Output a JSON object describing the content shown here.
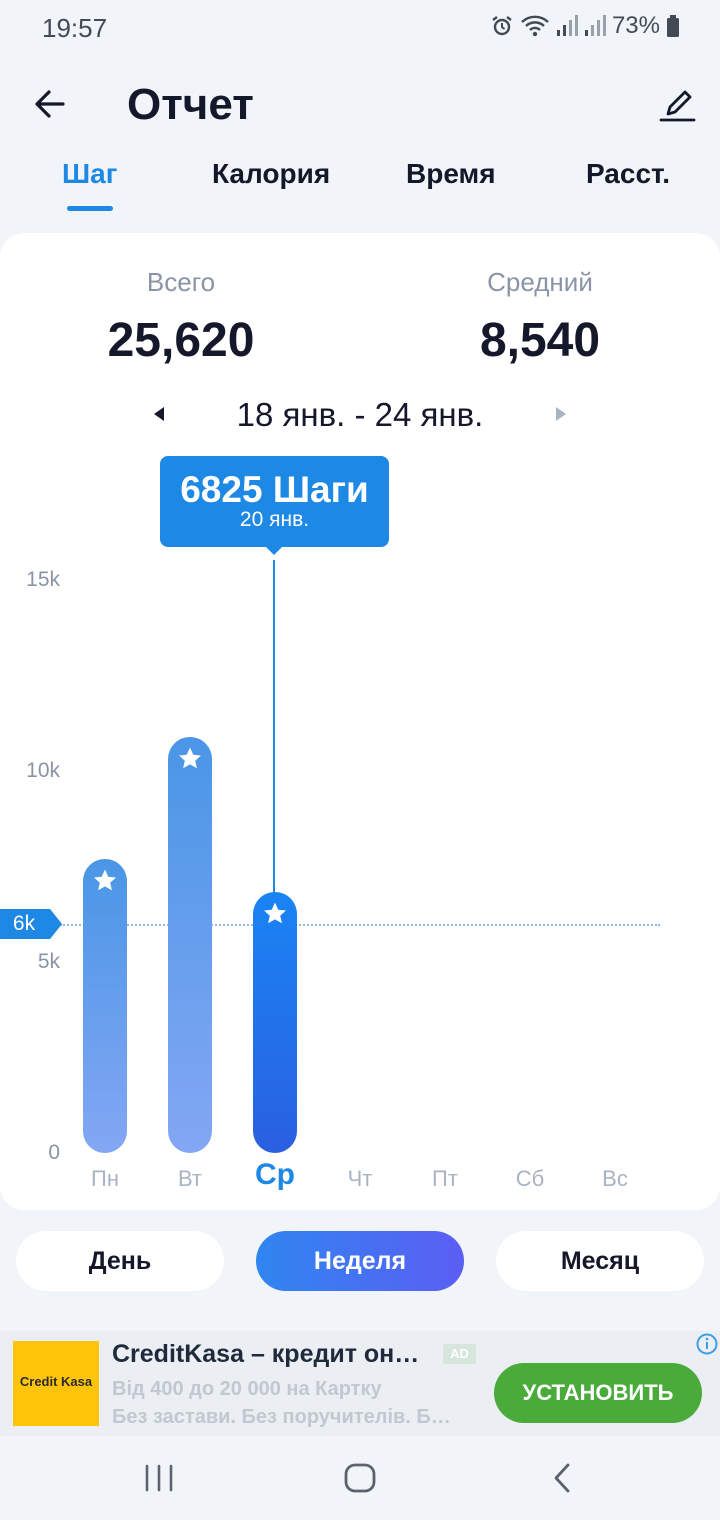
{
  "status_bar": {
    "time": "19:57",
    "battery": "73%"
  },
  "header": {
    "title": "Отчет"
  },
  "tabs": [
    {
      "label": "Шаг",
      "active": true
    },
    {
      "label": "Калория",
      "active": false
    },
    {
      "label": "Время",
      "active": false
    },
    {
      "label": "Расст.",
      "active": false
    }
  ],
  "summary": {
    "total_label": "Всего",
    "total_value": "25,620",
    "average_label": "Средний",
    "average_value": "8,540",
    "date_range": "18 янв. - 24 янв."
  },
  "tooltip": {
    "value": "6825 Шаги",
    "date": "20 янв."
  },
  "chart_data": {
    "type": "bar",
    "categories": [
      "Пн",
      "Вт",
      "Ср",
      "Чт",
      "Пт",
      "Сб",
      "Вс"
    ],
    "values": [
      7700,
      10900,
      6825,
      null,
      null,
      null,
      null
    ],
    "selected_index": 2,
    "y_ticks": [
      "0",
      "5k",
      "10k",
      "15k"
    ],
    "ylim": [
      0,
      15000
    ],
    "goal_line": {
      "value": 6000,
      "label": "6k"
    },
    "colors": {
      "bar": "#6aa6ec",
      "selected": "#1e78ee",
      "accent": "#1e88e5"
    }
  },
  "period": {
    "day_label": "День",
    "week_label": "Неделя",
    "month_label": "Месяц",
    "active": "week"
  },
  "ad": {
    "logo_text": "Credit Kasa",
    "title": "CreditKasa – кредит он…",
    "badge": "AD",
    "line1": "Від 400 до 20 000 на Картку",
    "line2": "Без застави. Без поручителів. Б…",
    "button": "УСТАНОВИТЬ"
  }
}
